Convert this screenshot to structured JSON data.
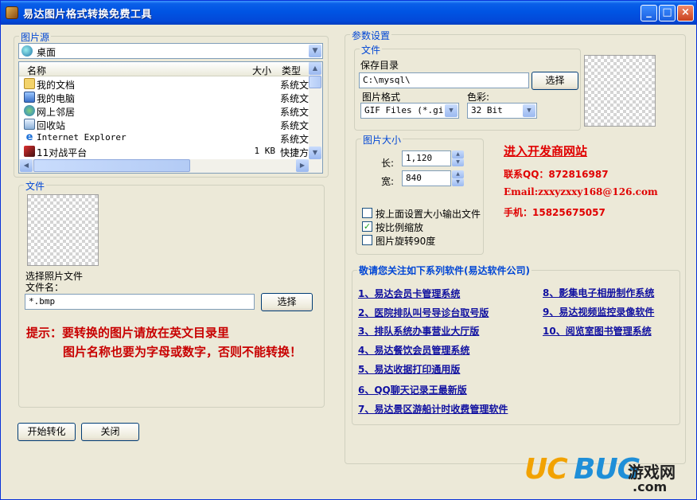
{
  "window": {
    "title": "易达图片格式转换免费工具",
    "minimize": "_",
    "maximize": "□",
    "close": "×"
  },
  "source": {
    "legend": "图片源",
    "drive": "桌面",
    "columns": {
      "name": "名称",
      "size": "大小",
      "type": "类型"
    },
    "items": [
      {
        "name": "我的文档",
        "size": "",
        "type": "系统文",
        "icon": "folder-icon"
      },
      {
        "name": "我的电脑",
        "size": "",
        "type": "系统文",
        "icon": "computer-icon"
      },
      {
        "name": "网上邻居",
        "size": "",
        "type": "系统文",
        "icon": "network-icon"
      },
      {
        "name": "回收站",
        "size": "",
        "type": "系统文",
        "icon": "recycle-bin-icon"
      },
      {
        "name": "Internet Explorer",
        "size": "",
        "type": "系统文",
        "icon": "ie-icon"
      },
      {
        "name": "11对战平台",
        "size": "1 KB",
        "type": "快捷方",
        "icon": "shortcut-icon"
      }
    ]
  },
  "file": {
    "legend": "文件",
    "select_label": "选择照片文件",
    "filename_label": "文件名：",
    "filename_value": "*.bmp",
    "browse": "选择"
  },
  "tips": {
    "line1": "提示：要转换的图片请放在英文目录里",
    "line2": "图片名称也要为字母或数字，否则不能转换！"
  },
  "buttons": {
    "start": "开始转化",
    "close": "关闭"
  },
  "params": {
    "legend": "参数设置",
    "file_legend": "文件",
    "save_dir_label": "保存目录",
    "save_dir_value": "C:\\mysql\\",
    "browse": "选择",
    "format_label": "图片格式",
    "format_value": "GIF Files (*.gif)",
    "color_label": "色彩:",
    "color_value": "32 Bit",
    "size_legend": "图片大小",
    "length_label": "长:",
    "length_value": "1,120",
    "width_label": "宽:",
    "width_value": "840",
    "options": [
      {
        "label": "按上面设置大小输出文件",
        "checked": false
      },
      {
        "label": "按比例缩放",
        "checked": true
      },
      {
        "label": "图片旋转90度",
        "checked": false
      }
    ]
  },
  "developer": {
    "site": "进入开发商网站",
    "qq": "联系QQ：872816987",
    "email": "Email:zxxyzxxy168@126.com",
    "phone": "手机：15825675057"
  },
  "series": {
    "title": "敬请您关注如下系列软件(易达软件公司)",
    "left": [
      "1、易达会员卡管理系统",
      "2、医院排队叫号导诊台取号版",
      "3、排队系统办事营业大厅版",
      "4、易达餐饮会员管理系统",
      "5、易达收据打印通用版",
      "6、QQ聊天记录王最新版",
      "7、易达景区游船计时收费管理软件"
    ],
    "right": [
      "8、影集电子相册制作系统",
      "9、易达视频监控录像软件",
      "10、阅览室图书管理系统"
    ]
  },
  "watermark": {
    "uc": "UC",
    "bug": "BUG",
    "cn": "游戏网",
    "com": ".com"
  }
}
